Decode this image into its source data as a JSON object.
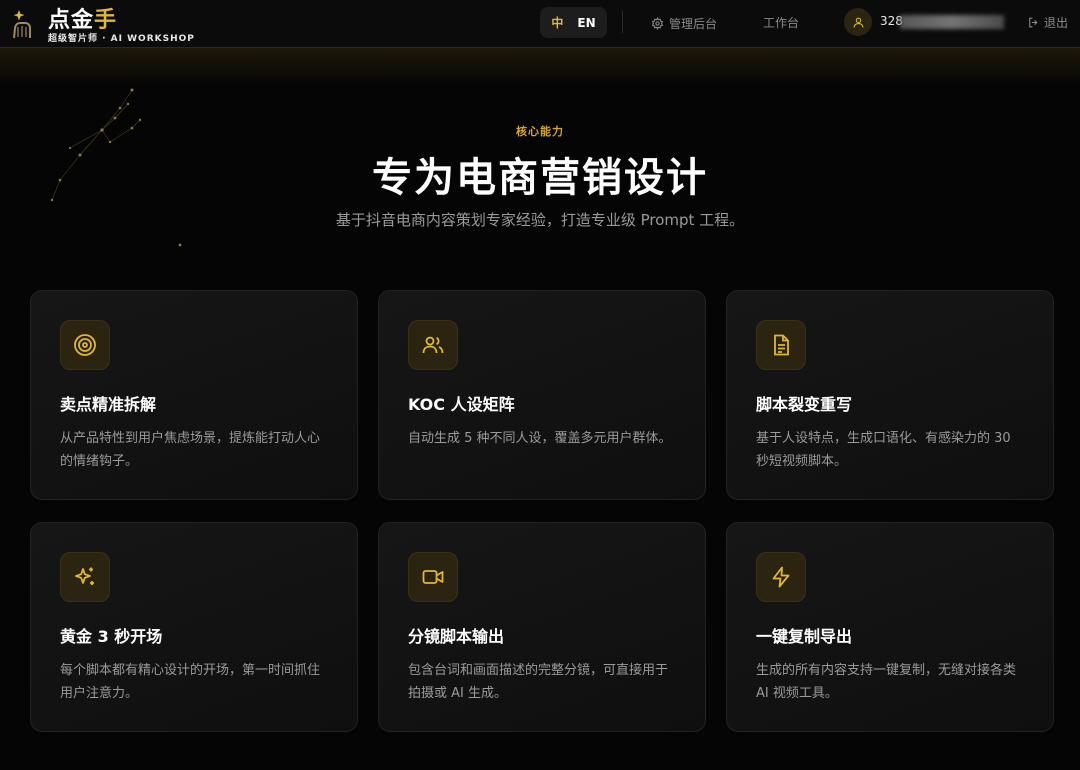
{
  "header": {
    "brand_name_main": "点金",
    "brand_name_accent": "手",
    "brand_subtitle": "超级智片师 · AI WORKSHOP",
    "lang_zh": "中",
    "lang_en": "EN",
    "nav_admin": "管理后台",
    "nav_workbench": "工作台",
    "user_id_visible": "328",
    "logout": "退出"
  },
  "hero": {
    "eyebrow": "核心能力",
    "title": "专为电商营销设计",
    "subtitle": "基于抖音电商内容策划专家经验，打造专业级 Prompt 工程。"
  },
  "features": [
    {
      "icon": "target-icon",
      "title": "卖点精准拆解",
      "description": "从产品特性到用户焦虑场景，提炼能打动人心的情绪钩子。"
    },
    {
      "icon": "users-icon",
      "title": "KOC 人设矩阵",
      "description": "自动生成 5 种不同人设，覆盖多元用户群体。"
    },
    {
      "icon": "document-icon",
      "title": "脚本裂变重写",
      "description": "基于人设特点，生成口语化、有感染力的 30 秒短视频脚本。"
    },
    {
      "icon": "sparkles-icon",
      "title": "黄金 3 秒开场",
      "description": "每个脚本都有精心设计的开场，第一时间抓住用户注意力。"
    },
    {
      "icon": "video-icon",
      "title": "分镜脚本输出",
      "description": "包含台词和画面描述的完整分镜，可直接用于拍摄或 AI 生成。"
    },
    {
      "icon": "lightning-icon",
      "title": "一键复制导出",
      "description": "生成的所有内容支持一键复制，无缝对接各类 AI 视频工具。"
    }
  ],
  "colors": {
    "accent": "#e0b73a",
    "background": "#050505",
    "card": "#141414",
    "muted_text": "#9a9a9a"
  }
}
